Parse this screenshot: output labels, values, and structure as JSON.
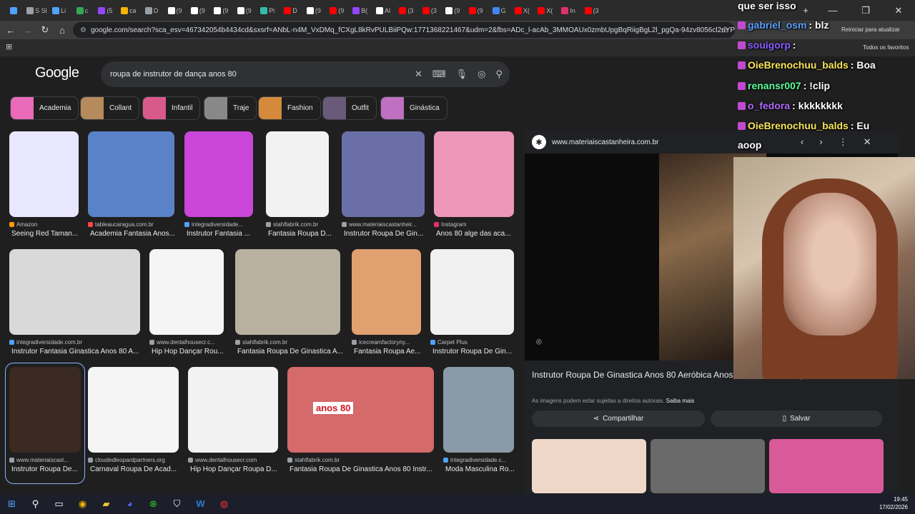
{
  "tabs": [
    {
      "icon": "gem",
      "label": "",
      "color": "#4fa3ff"
    },
    {
      "icon": "s",
      "label": "S Sl",
      "color": "#9aa0a6"
    },
    {
      "icon": "cloud",
      "label": "Li",
      "color": "#4fa3ff"
    },
    {
      "icon": "drive",
      "label": "c",
      "color": "#34a853"
    },
    {
      "icon": "twitch",
      "label": "(5",
      "color": "#9146ff"
    },
    {
      "icon": "crown",
      "label": "ca",
      "color": "#f4b400"
    },
    {
      "icon": "globe",
      "label": "D",
      "color": "#9aa0a6"
    },
    {
      "icon": "tiktok",
      "label": "(9",
      "color": "#fff"
    },
    {
      "icon": "tiktok",
      "label": "(9",
      "color": "#fff"
    },
    {
      "icon": "tiktok",
      "label": "(9",
      "color": "#fff"
    },
    {
      "icon": "tiktok",
      "label": "(9",
      "color": "#fff"
    },
    {
      "icon": "pix",
      "label": "Pi",
      "color": "#32bcad"
    },
    {
      "icon": "youtube",
      "label": "D",
      "color": "#ff0000"
    },
    {
      "icon": "tiktok",
      "label": "(9",
      "color": "#fff"
    },
    {
      "icon": "youtube",
      "label": "(9",
      "color": "#ff0000"
    },
    {
      "icon": "twitch",
      "label": "B(",
      "color": "#9146ff"
    },
    {
      "icon": "tiktok",
      "label": "Al",
      "color": "#fff"
    },
    {
      "icon": "youtube",
      "label": "(3",
      "color": "#ff0000"
    },
    {
      "icon": "youtube",
      "label": "(3",
      "color": "#ff0000"
    },
    {
      "icon": "tiktok",
      "label": "(9",
      "color": "#fff"
    },
    {
      "icon": "youtube",
      "label": "(9",
      "color": "#ff0000"
    },
    {
      "icon": "google",
      "label": "G",
      "color": "#4285f4"
    },
    {
      "icon": "youtube",
      "label": "X(",
      "color": "#ff0000"
    },
    {
      "icon": "youtube",
      "label": "X(",
      "color": "#ff0000"
    },
    {
      "icon": "instagram",
      "label": "In",
      "color": "#e1306c"
    },
    {
      "icon": "youtube",
      "label": "(3",
      "color": "#ff0000"
    }
  ],
  "window": {
    "new_tab": "+",
    "minimize": "—",
    "restore": "❐",
    "close": "✕"
  },
  "toolbar": {
    "back": "←",
    "forward": "→",
    "reload": "↻",
    "home": "⌂",
    "url": "google.com/search?sca_esv=467342054b4434cd&sxsrf=ANbL-n4M_VxDMq_fCXgL8kRvPULBiiPQw:1771368221467&udm=2&fbs=ADc_l-acAb_3MMOAUx0zmbUpgBqRiigBgL2l_pgQa-94zv8056cl2nYPtvTKf42U...",
    "star": "☆",
    "update_label": "Reiniciar para atualizar",
    "favorites_label": "Todos os favoritos"
  },
  "google": {
    "logo": "Google",
    "query": "roupa de instrutor de dança anos 80"
  },
  "chips": [
    {
      "label": "Academia",
      "color": "#e86ab8"
    },
    {
      "label": "Collant",
      "color": "#b58a5c"
    },
    {
      "label": "Infantil",
      "color": "#d75a8a"
    },
    {
      "label": "Traje",
      "color": "#888"
    },
    {
      "label": "Fashion",
      "color": "#d48a3a"
    },
    {
      "label": "Outfit",
      "color": "#6a5a7a"
    },
    {
      "label": "Ginástica",
      "color": "#c070c0"
    }
  ],
  "results": [
    {
      "source": "Amazon",
      "title": "Seeing Red Taman...",
      "color": "#e9e6ff",
      "fav": "#ff9900"
    },
    {
      "source": "tableaucaragua.com.br",
      "title": "Academia Fantasia Anos...",
      "color": "#5a82c8",
      "fav": "#ff4444"
    },
    {
      "source": "integradiversidade...",
      "title": "Instrutor Fantasia ...",
      "color": "#c946d8",
      "fav": "#4fa3ff"
    },
    {
      "source": "stahlfabrik.com.br",
      "title": "Fantasia Roupa D...",
      "color": "#f2f2f2",
      "fav": "#9aa0a6"
    },
    {
      "source": "www.materiaiscastanheir...",
      "title": "Instrutor Roupa De Gin...",
      "color": "#6a6fa8",
      "fav": "#9aa0a6"
    },
    {
      "source": "Instagram",
      "title": "Anos 80 alge das aca...",
      "color": "#ec96b8",
      "fav": "#e1306c"
    },
    {
      "source": "integradiversidade.com.br",
      "title": "Instrutor Fantasia Ginastica Anos 80 A...",
      "color": "#d9d9d9",
      "fav": "#4fa3ff"
    },
    {
      "source": "www.dentalhousecr.c...",
      "title": "Hip Hop Dançar Rou...",
      "color": "#f5f5f5",
      "fav": "#9aa0a6"
    },
    {
      "source": "stahlfabrik.com.br",
      "title": "Fantasia Roupa De Ginastica A...",
      "color": "#b8b0a0",
      "fav": "#9aa0a6"
    },
    {
      "source": "icecreamfactoryny...",
      "title": "Fantasia Roupa Ae...",
      "color": "#e0a070",
      "fav": "#9aa0a6"
    },
    {
      "source": "Carpet Plus",
      "title": "Instrutor Roupa De Gin...",
      "color": "#f0f0f0",
      "fav": "#4fa3ff"
    },
    {
      "source": "www.materiaiscast...",
      "title": "Instrutor Roupa De...",
      "color": "#3a2a22",
      "fav": "#9aa0a6"
    },
    {
      "source": "cloudedleopardpartners.org",
      "title": "Carnaval Roupa De Acad...",
      "color": "#f5f5f5",
      "fav": "#9aa0a6"
    },
    {
      "source": "www.dentalhousecr.com",
      "title": "Hip Hop Dançar Roupa D...",
      "color": "#f2f2f2",
      "fav": "#9aa0a6"
    },
    {
      "source": "stahlfabrik.com.br",
      "title": "Fantasia Roupa De Ginastica Anos 80 Instr...",
      "color": "#d46a6a",
      "fav": "#9aa0a6"
    },
    {
      "source": "integradiversidade.c...",
      "title": "Moda Masculina Ro...",
      "color": "#8a9aa8",
      "fav": "#4fa3ff"
    }
  ],
  "overlay_text": "anos 80",
  "panel": {
    "site": "www.materiaiscastanheira.com.br",
    "title": "Instrutor Roupa De Ginastica Anos 80 Aeróbica Anos 80 Moda De Roupa Dos",
    "copyright": "As imagens podem estar sujeitas a direitos autorais.",
    "learn_more": "Saiba mais",
    "share": "Compartilhar",
    "save": "Salvar"
  },
  "chat": [
    {
      "user": "que ser isso",
      "msg": "",
      "color": "#ffffff"
    },
    {
      "user": "gabriel_osm",
      "msg": ": blz",
      "color": "#5aa0ff"
    },
    {
      "user": "souigorp",
      "msg": ":",
      "color": "#8a5cff"
    },
    {
      "user": "OieBrenochuu_balds",
      "msg": ": Boa",
      "color": "#f8e65a"
    },
    {
      "user": "renansr007",
      "msg": ": !clip",
      "color": "#5cff9a"
    },
    {
      "user": "o_fedora",
      "msg": ": kkkkkkkk",
      "color": "#b06aff"
    },
    {
      "user": "OieBrenochuu_balds",
      "msg": ": Eu",
      "color": "#f8e65a"
    },
    {
      "user": "aoop",
      "msg": "",
      "color": "#ffffff"
    }
  ],
  "taskbar": {
    "time": "19:45",
    "date": "17/02/2026"
  }
}
